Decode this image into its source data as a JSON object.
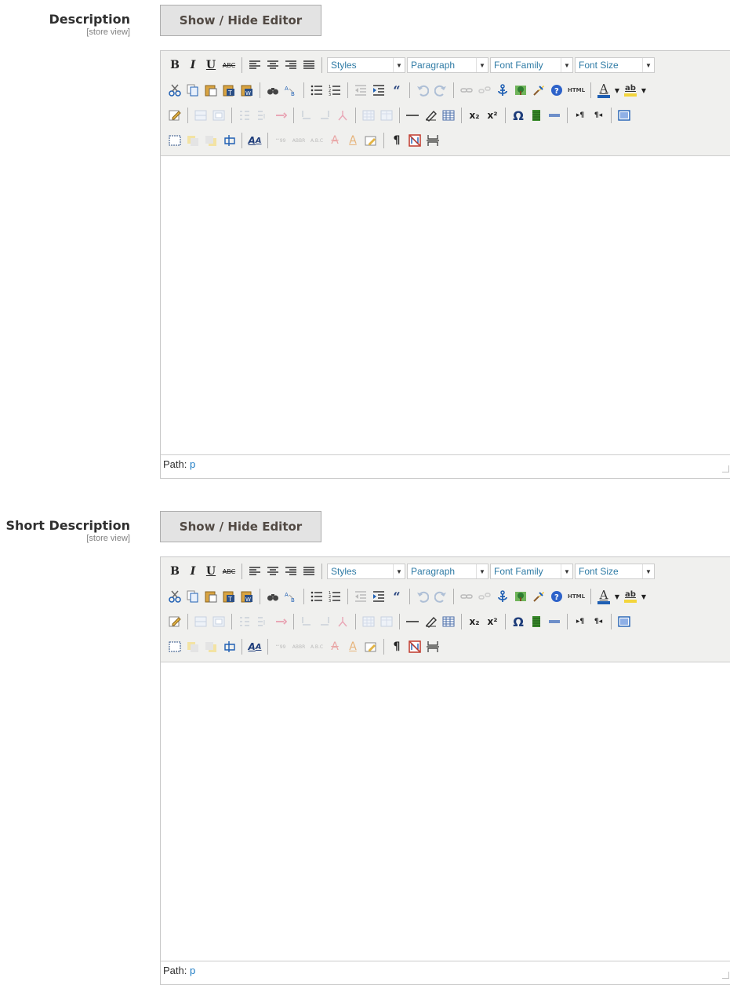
{
  "fields": [
    {
      "label": "Description",
      "scope": "[store view]",
      "toggle_label": "Show / Hide Editor",
      "toolbar": {
        "styles": "Styles",
        "paragraph": "Paragraph",
        "font_family": "Font Family",
        "font_size": "Font Size"
      },
      "path_label": "Path:",
      "path_value": "p"
    },
    {
      "label": "Short Description",
      "scope": "[store view]",
      "toggle_label": "Show / Hide Editor",
      "toolbar": {
        "styles": "Styles",
        "paragraph": "Paragraph",
        "font_family": "Font Family",
        "font_size": "Font Size"
      },
      "path_label": "Path:",
      "path_value": "p"
    }
  ],
  "toolbar_icons": {
    "bold": "B",
    "italic": "I",
    "underline": "U",
    "strikethrough": "ABC",
    "html": "HTML",
    "subscript": "x₂",
    "superscript": "x²",
    "omega": "Ω",
    "pilcrow": "¶",
    "text_color": "A",
    "highlight": "ab"
  }
}
